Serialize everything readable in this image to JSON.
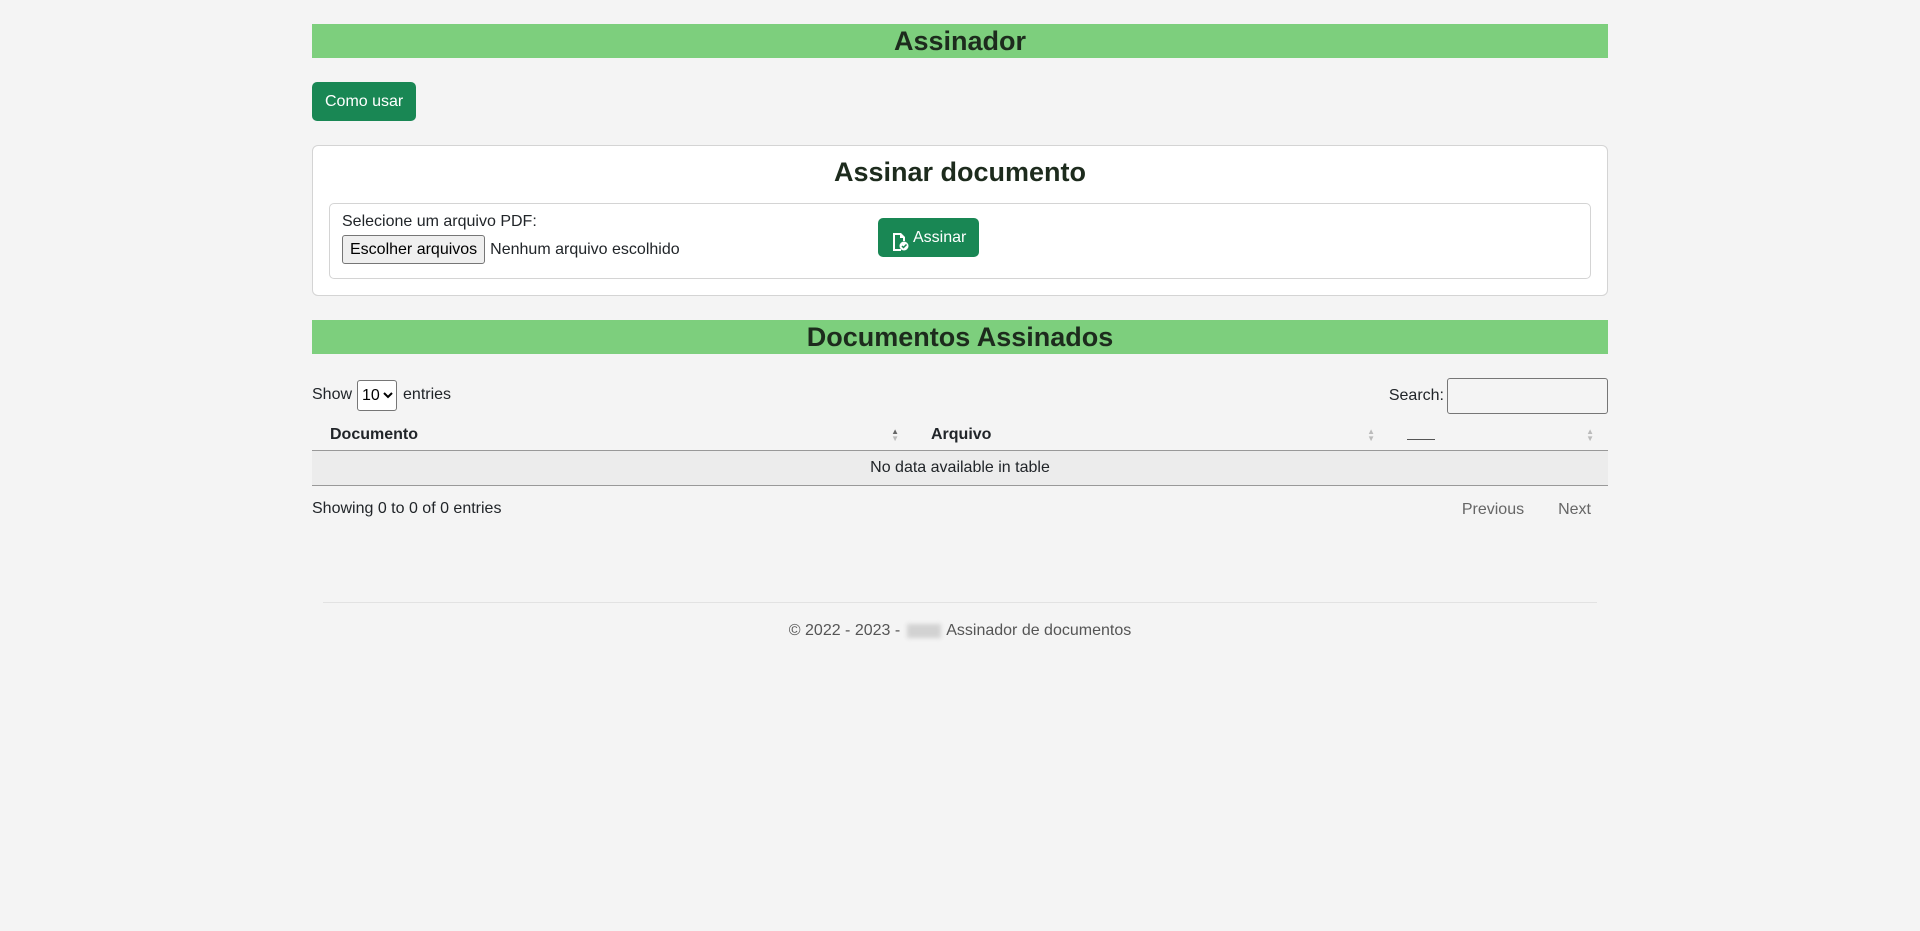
{
  "header": {
    "title": "Assinador"
  },
  "how_to_button": {
    "label": "Como usar"
  },
  "sign_card": {
    "title": "Assinar documento",
    "file_label": "Selecione um arquivo PDF:",
    "file_button": "Escolher arquivos",
    "file_status": "Nenhum arquivo escolhido",
    "sign_button": "Assinar"
  },
  "signed_section": {
    "title": "Documentos Assinados"
  },
  "table_controls": {
    "show_label": "Show",
    "entries_label": "entries",
    "page_length": "10",
    "search_label": "Search:"
  },
  "table": {
    "columns": [
      "Documento",
      "Arquivo",
      ""
    ],
    "empty_message": "No data available in table"
  },
  "table_footer": {
    "info": "Showing 0 to 0 of 0 entries",
    "previous": "Previous",
    "next": "Next"
  },
  "footer": {
    "prefix": "© 2022 - 2023 -",
    "suffix": "Assinador de documentos"
  },
  "colors": {
    "banner": "#7dcf7d",
    "primary_button": "#198754",
    "page_background": "#f4f4f4"
  }
}
